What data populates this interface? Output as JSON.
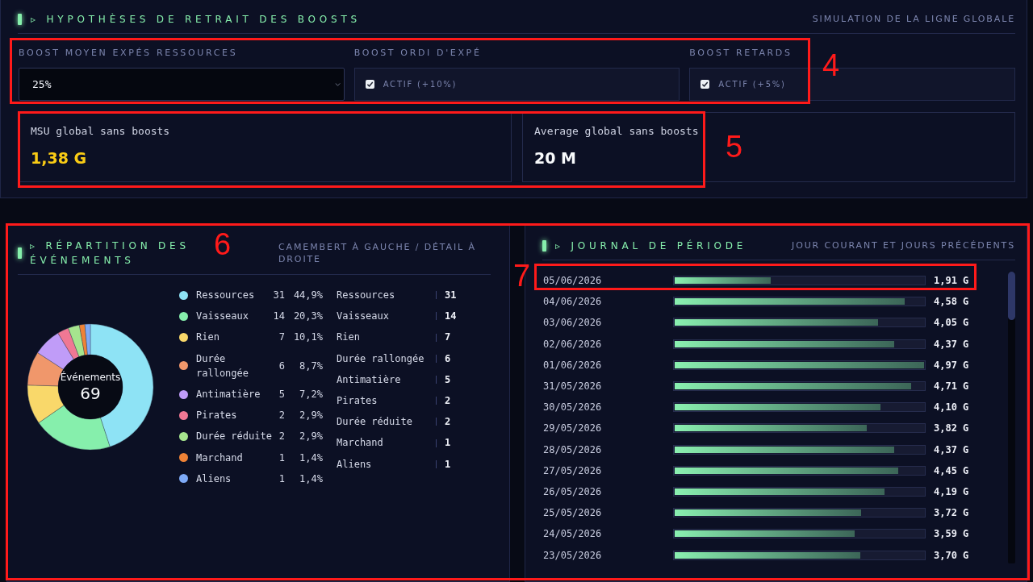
{
  "hypotheses": {
    "title": "▹ HYPOTHÈSES DE RETRAIT DES BOOSTS",
    "subtitle": "SIMULATION DE LA LIGNE GLOBALE",
    "controls": [
      {
        "kind": "select",
        "label": "BOOST MOYEN EXPÉS RESSOURCES",
        "value": "25%"
      },
      {
        "kind": "checkbox",
        "label": "BOOST ORDI D'EXPÉ",
        "text": "ACTIF (+10%)",
        "checked": true
      },
      {
        "kind": "checkbox",
        "label": "BOOST RETARDS",
        "text": "ACTIF (+5%)",
        "checked": true
      }
    ],
    "metrics": [
      {
        "label": "MSU global sans boosts",
        "value": "1,38 G",
        "color": "#facc15"
      },
      {
        "label": "Average global sans boosts",
        "value": "20 M",
        "color": "#f8fafc"
      }
    ]
  },
  "distribution": {
    "title": "▹ RÉPARTITION DES ÉVÉNEMENTS",
    "subtitle": "CAMEMBERT À GAUCHE / DÉTAIL À DROITE",
    "center_label": "Événements",
    "center_value": "69",
    "chart_data": {
      "type": "donut",
      "categories": [
        "Ressources",
        "Vaisseaux",
        "Rien",
        "Durée rallongée",
        "Antimatière",
        "Pirates",
        "Durée réduite",
        "Marchand",
        "Aliens"
      ],
      "values": [
        44.9,
        20.3,
        10.1,
        8.7,
        7.2,
        2.9,
        2.9,
        1.4,
        1.4
      ],
      "colors": [
        "#8ee3f5",
        "#86efac",
        "#f9d86a",
        "#f0976b",
        "#c09cf8",
        "#f07894",
        "#a6e58e",
        "#ee8236",
        "#7eaaf6"
      ],
      "legend": "right"
    },
    "legend_figures": [
      {
        "count": "31",
        "share": "44,9%"
      },
      {
        "count": "14",
        "share": "20,3%"
      },
      {
        "count": "7",
        "share": "10,1%"
      },
      {
        "count": "6",
        "share": "8,7%"
      },
      {
        "count": "5",
        "share": "7,2%"
      },
      {
        "count": "2",
        "share": "2,9%"
      },
      {
        "count": "2",
        "share": "2,9%"
      },
      {
        "count": "1",
        "share": "1,4%"
      },
      {
        "count": "1",
        "share": "1,4%"
      }
    ],
    "details": [
      {
        "name": "Ressources",
        "count": "31"
      },
      {
        "name": "Vaisseaux",
        "count": "14"
      },
      {
        "name": "Rien",
        "count": "7"
      },
      {
        "name": "Durée rallongée",
        "count": "6"
      },
      {
        "name": "Antimatière",
        "count": "5"
      },
      {
        "name": "Pirates",
        "count": "2"
      },
      {
        "name": "Durée réduite",
        "count": "2"
      },
      {
        "name": "Marchand",
        "count": "1"
      },
      {
        "name": "Aliens",
        "count": "1"
      }
    ]
  },
  "journal": {
    "title": "▹ JOURNAL DE PÉRIODE",
    "subtitle": "JOUR COURANT ET JOURS PRÉCÉDENTS",
    "rows": [
      {
        "date": "05/06/2026",
        "level": 0.384,
        "value": "1,91 G"
      },
      {
        "date": "04/06/2026",
        "level": 0.921,
        "value": "4,58 G"
      },
      {
        "date": "03/06/2026",
        "level": 0.815,
        "value": "4,05 G"
      },
      {
        "date": "02/06/2026",
        "level": 0.879,
        "value": "4,37 G"
      },
      {
        "date": "01/06/2026",
        "level": 1,
        "value": "4,97 G"
      },
      {
        "date": "31/05/2026",
        "level": 0.948,
        "value": "4,71 G"
      },
      {
        "date": "30/05/2026",
        "level": 0.825,
        "value": "4,10 G"
      },
      {
        "date": "29/05/2026",
        "level": 0.769,
        "value": "3,82 G"
      },
      {
        "date": "28/05/2026",
        "level": 0.879,
        "value": "4,37 G"
      },
      {
        "date": "27/05/2026",
        "level": 0.895,
        "value": "4,45 G"
      },
      {
        "date": "26/05/2026",
        "level": 0.843,
        "value": "4,19 G"
      },
      {
        "date": "25/05/2026",
        "level": 0.748,
        "value": "3,72 G"
      },
      {
        "date": "24/05/2026",
        "level": 0.722,
        "value": "3,59 G"
      },
      {
        "date": "23/05/2026",
        "level": 0.744,
        "value": "3,70 G"
      }
    ]
  },
  "annotations": [
    {
      "label": "4"
    },
    {
      "label": "5"
    },
    {
      "label": "6"
    },
    {
      "label": "7"
    }
  ]
}
